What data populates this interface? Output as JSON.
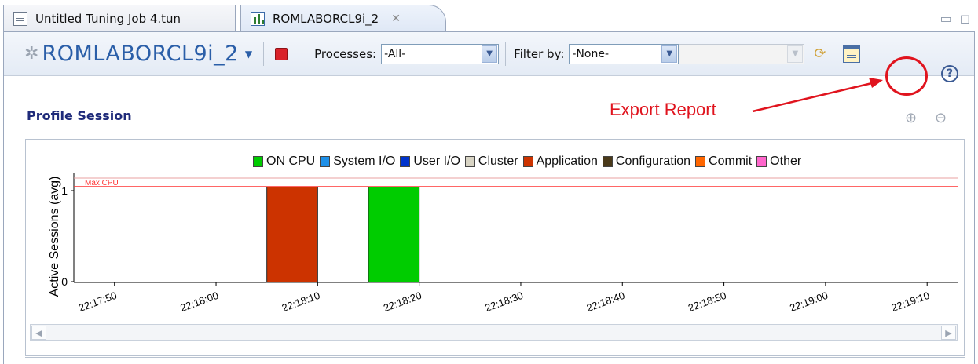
{
  "tabs": [
    {
      "label": "Untitled Tuning Job 4.tun",
      "icon": "document-icon"
    },
    {
      "label": "ROMLABORCL9i_2",
      "icon": "chart-icon",
      "close": "✕"
    }
  ],
  "window_controls": {
    "minimize": "▭",
    "maximize": "◻"
  },
  "toolbar": {
    "session_title": "ROMLABORCL9i_2",
    "processes_label": "Processes:",
    "processes_value": "-All-",
    "filter_label": "Filter by:",
    "filter_value": "-None-",
    "filter_value_2": "",
    "help": "?"
  },
  "section": {
    "title": "Profile Session",
    "annotation": "Export Report"
  },
  "colors": {
    "accent": "#e0141e",
    "title_blue": "#2a5ea8",
    "on_cpu": "#00cc00",
    "application": "#cc3300"
  },
  "chart_data": {
    "type": "bar",
    "ylabel": "Active Sessions (avg)",
    "xlabel": "",
    "ylim": [
      0,
      1
    ],
    "yticks": [
      "0",
      "1"
    ],
    "xticks": [
      "22:17:50",
      "22:18:00",
      "22:18:10",
      "22:18:20",
      "22:18:30",
      "22:18:40",
      "22:18:50",
      "22:19:00",
      "22:19:10"
    ],
    "reference_line": {
      "label": "Max CPU",
      "value": 1
    },
    "legend": [
      {
        "name": "ON CPU",
        "color": "#00cc00"
      },
      {
        "name": "System I/O",
        "color": "#1e90e8"
      },
      {
        "name": "User I/O",
        "color": "#0033cc"
      },
      {
        "name": "Cluster",
        "color": "#d8d4c4"
      },
      {
        "name": "Application",
        "color": "#cc3300"
      },
      {
        "name": "Configuration",
        "color": "#4a3a1a"
      },
      {
        "name": "Commit",
        "color": "#ff6600"
      },
      {
        "name": "Other",
        "color": "#ff66cc"
      }
    ],
    "bars": [
      {
        "series": "Application",
        "x_start": "22:18:05",
        "x_end": "22:18:10",
        "value": 1
      },
      {
        "series": "ON CPU",
        "x_start": "22:18:15",
        "x_end": "22:18:20",
        "value": 1
      }
    ]
  }
}
